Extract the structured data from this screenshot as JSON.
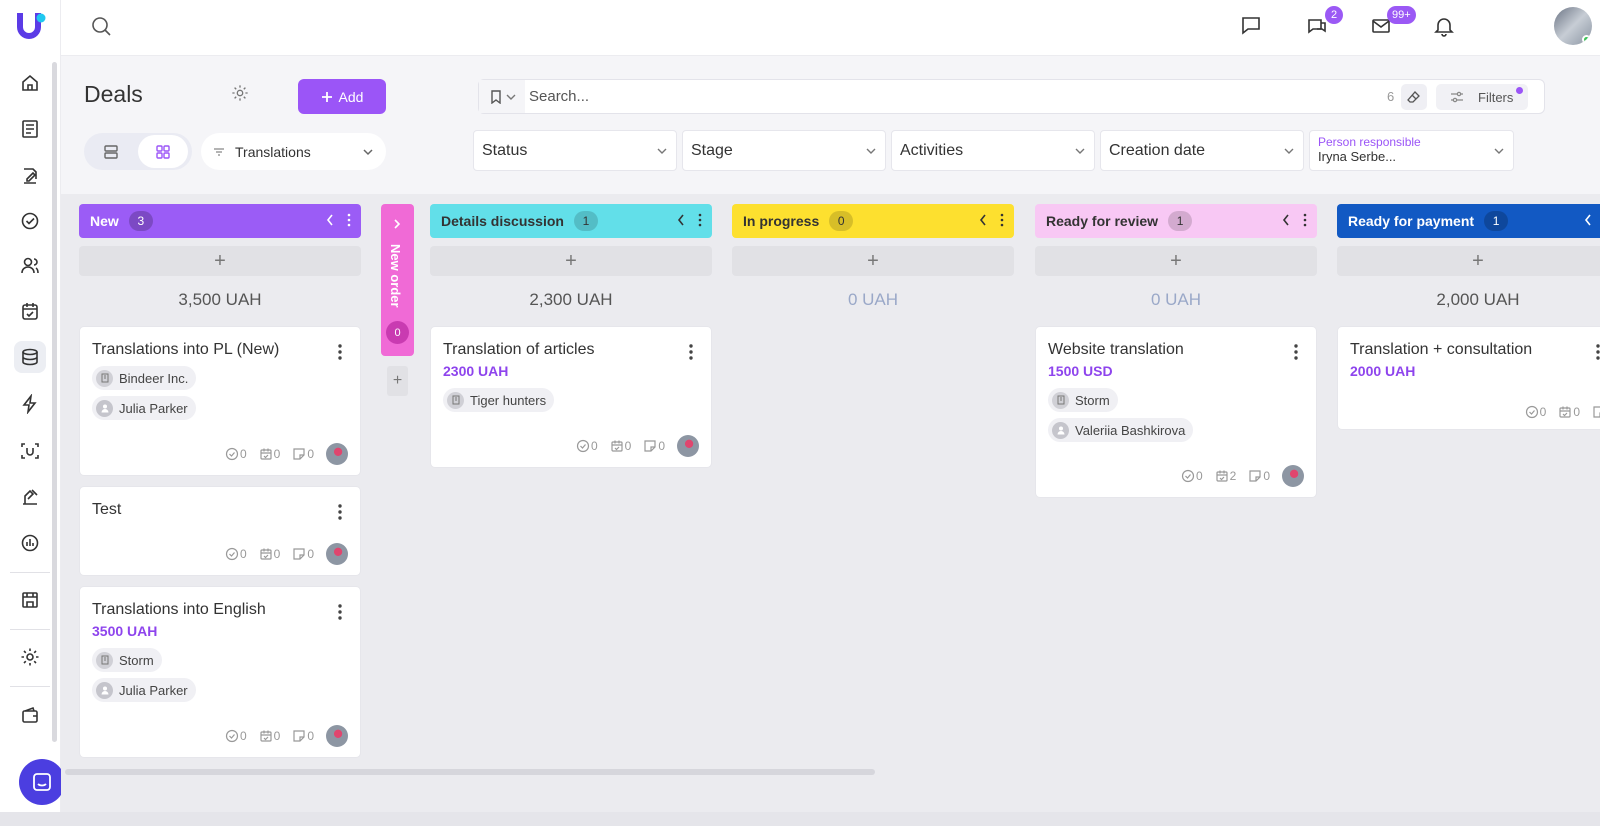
{
  "header": {
    "title": "Deals",
    "add_label": "Add",
    "pipeline": "Translations",
    "search_placeholder": "Search...",
    "search_count": "6",
    "filters_label": "Filters"
  },
  "topbar": {
    "chat_badge": "2",
    "mail_badge": "99+"
  },
  "filters": [
    {
      "label": "Status"
    },
    {
      "label": "Stage"
    },
    {
      "label": "Activities"
    },
    {
      "label": "Creation date"
    },
    {
      "label": "Person responsible",
      "value": "Iryna Serbe..."
    }
  ],
  "colors": {
    "accent": "#9b55f7",
    "amount": "#8e44ed"
  },
  "columns": [
    {
      "name": "New",
      "count": "3",
      "total": "3,500 UAH",
      "color": "#9b5cf6",
      "text_color": "#ffffff",
      "cards": [
        {
          "title": "Translations into PL (New)",
          "amount": "",
          "company": "Bindeer Inc.",
          "contact": "Julia Parker",
          "tasks": "0",
          "events": "0",
          "notes": "0"
        },
        {
          "title": "Test",
          "amount": "",
          "company": "",
          "contact": "",
          "tasks": "0",
          "events": "0",
          "notes": "0"
        },
        {
          "title": "Translations into English",
          "amount": "3500 UAH",
          "company": "Storm",
          "contact": "Julia Parker",
          "tasks": "0",
          "events": "0",
          "notes": "0"
        }
      ]
    },
    {
      "name": "New order",
      "count": "0",
      "collapsed": true,
      "color": "#f06ad6"
    },
    {
      "name": "Details discussion",
      "count": "1",
      "total": "2,300 UAH",
      "color": "#62dfe9",
      "text_color": "#333333",
      "cards": [
        {
          "title": "Translation of articles",
          "amount": "2300 UAH",
          "company": "Tiger hunters",
          "contact": "",
          "tasks": "0",
          "events": "0",
          "notes": "0"
        }
      ]
    },
    {
      "name": "In progress",
      "count": "0",
      "total": "0 UAH",
      "color": "#fde02f",
      "text_color": "#333333",
      "cards": []
    },
    {
      "name": "Ready for review",
      "count": "1",
      "total": "0 UAH",
      "color": "#f8c8f4",
      "text_color": "#333333",
      "cards": [
        {
          "title": "Website translation",
          "amount": "1500 USD",
          "company": "Storm",
          "contact": "Valeriia Bashkirova",
          "tasks": "0",
          "events": "2",
          "notes": "0"
        }
      ]
    },
    {
      "name": "Ready for payment",
      "count": "1",
      "total": "2,000 UAH",
      "color": "#1259c3",
      "text_color": "#ffffff",
      "cards": [
        {
          "title": "Translation + consultation",
          "amount": "2000 UAH",
          "company": "",
          "contact": "",
          "tasks": "0",
          "events": "0",
          "notes": ""
        }
      ]
    }
  ]
}
